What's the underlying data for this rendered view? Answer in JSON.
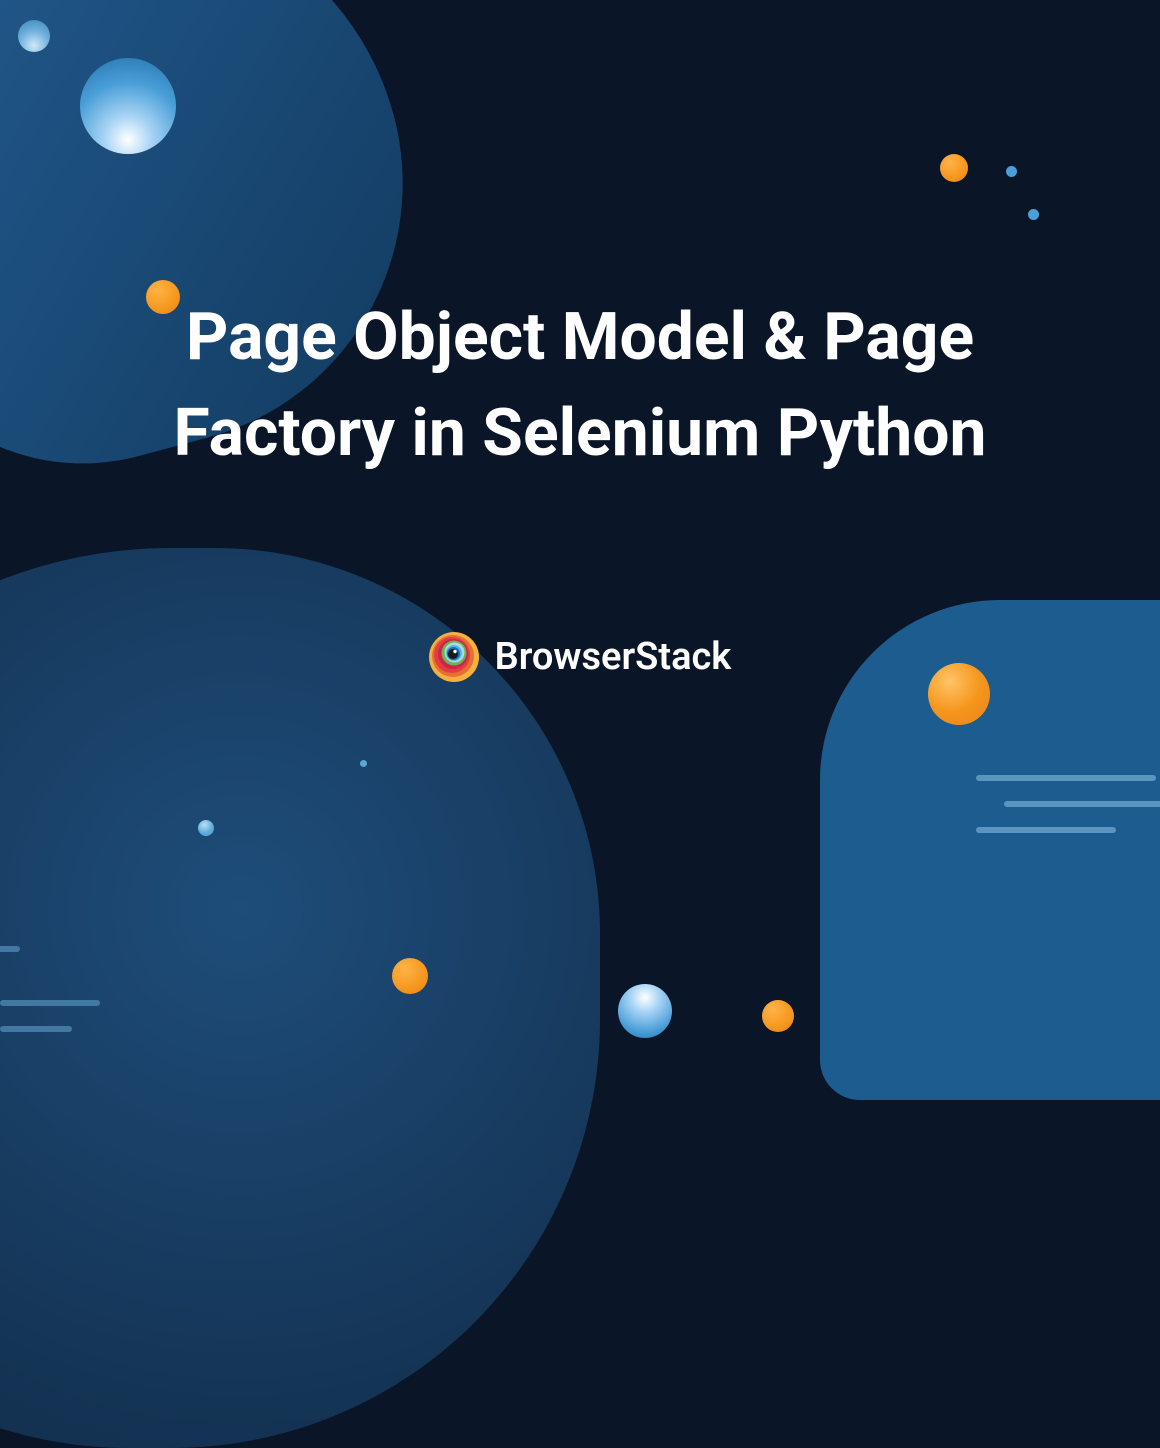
{
  "title": "Page Object Model & Page Factory in Selenium Python",
  "brand": {
    "name": "BrowserStack"
  }
}
